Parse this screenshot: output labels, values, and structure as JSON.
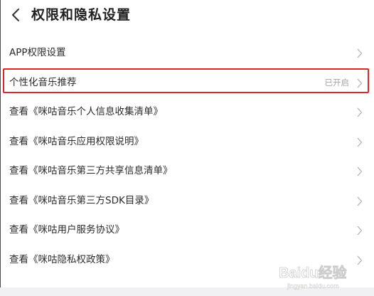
{
  "header": {
    "title": "权限和隐私设置"
  },
  "list": {
    "items": [
      {
        "label": "APP权限设置",
        "status": ""
      },
      {
        "label": "个性化音乐推荐",
        "status": "已开启"
      },
      {
        "label": "查看《咪咕音乐个人信息收集清单》",
        "status": ""
      },
      {
        "label": "查看《咪咕音乐应用权限说明》",
        "status": ""
      },
      {
        "label": "查看《咪咕音乐第三方共享信息清单》",
        "status": ""
      },
      {
        "label": "查看《咪咕音乐第三方SDK目录》",
        "status": ""
      },
      {
        "label": "查看《咪咕用户服务协议》",
        "status": ""
      },
      {
        "label": "查看《咪咕隐私权政策》",
        "status": ""
      }
    ]
  },
  "highlight": {
    "color": "#e0242b",
    "target": "个性化音乐推荐"
  },
  "watermark": {
    "text": "Baidu经验",
    "url_text": "jingyan.baidu.com"
  }
}
